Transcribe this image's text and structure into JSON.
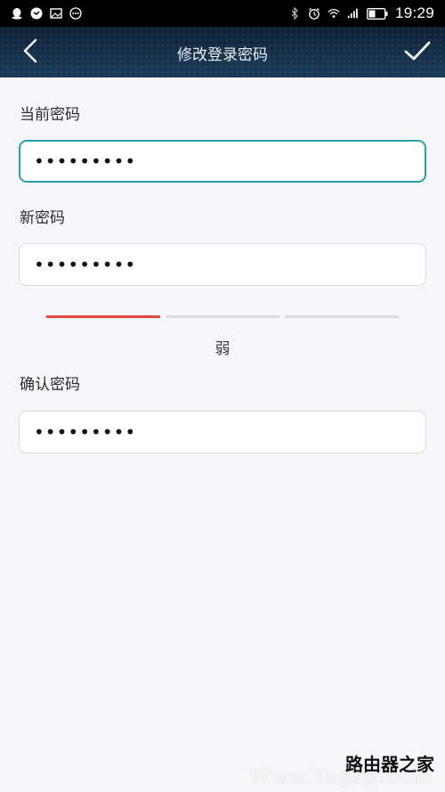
{
  "status_bar": {
    "time": "19:29",
    "left_icons": [
      "qq-icon",
      "message-icon",
      "image-icon",
      "more-dots-icon"
    ],
    "right_icons": [
      "bluetooth-icon",
      "alarm-icon",
      "wifi-icon",
      "signal-icon",
      "battery-icon"
    ]
  },
  "nav": {
    "title": "修改登录密码",
    "back_icon": "chevron-left-icon",
    "confirm_icon": "check-icon"
  },
  "form": {
    "current_password": {
      "label": "当前密码",
      "value": "•••••••••"
    },
    "new_password": {
      "label": "新密码",
      "value": "•••••••••"
    },
    "confirm_password": {
      "label": "确认密码",
      "value": "•••••••••"
    }
  },
  "strength": {
    "level_text": "弱",
    "active_segments": 1,
    "total_segments": 3,
    "active_color": "#e0493b",
    "inactive_color": "#dcdbdf"
  },
  "colors": {
    "focus_border": "#2a9fa6",
    "nav_background": "#173149"
  },
  "watermark": {
    "main": "路由器之家",
    "url": "Www.Tagxp.com"
  }
}
